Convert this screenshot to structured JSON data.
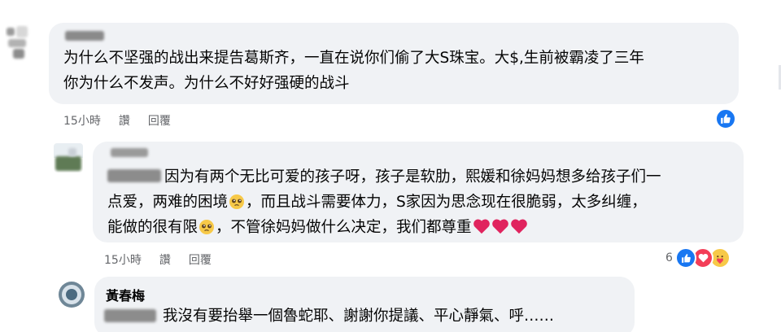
{
  "comments": [
    {
      "id": "c1",
      "lines": [
        "为什么不坚强的战出来提告葛斯齐，一直在说你们偷了大S珠宝。大$,生前被霸凌了三年",
        "你为什么不发声。为什么不好好强硬的战斗"
      ],
      "time": "15小時",
      "like_label": "讚",
      "reply_label": "回覆",
      "reaction_icon": "like-icon"
    },
    {
      "id": "c2",
      "line1": "因为有两个无比可爱的孩子呀，孩子是软肋，熙媛和徐妈妈想多给孩子们一",
      "line2_a": "点爱，两难的困境",
      "line2_b": "，而且战斗需要体力，S家因为思念现在很脆弱，太多纠缠，",
      "line3_a": "能做的很有限",
      "line3_b": "，不管徐妈妈做什么决定，我们都尊重",
      "emoji_name": "pleading-face-icon",
      "hearts": [
        "heart-icon",
        "heart-icon",
        "heart-icon"
      ],
      "time": "15小時",
      "like_label": "讚",
      "reply_label": "回覆",
      "reaction_count": "6",
      "reaction_icons": [
        "like-icon",
        "love-icon",
        "care-icon"
      ]
    },
    {
      "id": "c3",
      "author": "黃春梅",
      "text": "我沒有要抬舉一個魯蛇耶、謝謝你提議、平心靜氣、呼……"
    }
  ],
  "colors": {
    "bubble": "#f0f2f5",
    "meta": "#65676b",
    "like_blue": "#1877f2",
    "love_red": "#f33e58",
    "heart_red": "#e0245e",
    "emoji_yellow": "#f7c948"
  }
}
